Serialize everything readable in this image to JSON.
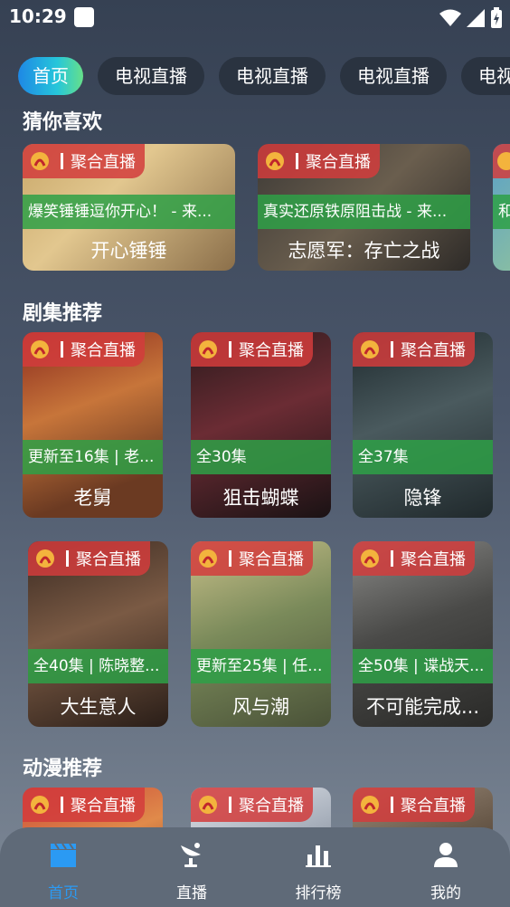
{
  "status": {
    "time": "10:29"
  },
  "tabs": [
    "首页",
    "电视直播",
    "电视直播",
    "电视直播",
    "电视"
  ],
  "sections": {
    "guess": "猜你喜欢",
    "series": "剧集推荐",
    "anime": "动漫推荐"
  },
  "tag_label": "聚合直播",
  "guess_cards": [
    {
      "info": "爆笑锤锤逗你开心！ - 来...",
      "title": "开心锤锤"
    },
    {
      "info": "真实还原铁原阻击战 - 来...",
      "title": "志愿军：存亡之战"
    },
    {
      "info": "和",
      "title": ""
    }
  ],
  "series_cards": [
    {
      "info": "更新至16集 | 老...",
      "title": "老舅"
    },
    {
      "info": "全30集",
      "title": "狙击蝴蝶"
    },
    {
      "info": "全37集",
      "title": "隐锋"
    },
    {
      "info": "全40集 | 陈晓整...",
      "title": "大生意人"
    },
    {
      "info": "更新至25集 | 任...",
      "title": "风与潮"
    },
    {
      "info": "全50集 | 谍战天...",
      "title": "不可能完成..."
    }
  ],
  "anime_cards": [
    {
      "title": ""
    },
    {
      "title": ""
    },
    {
      "title": ""
    }
  ],
  "nav": [
    "首页",
    "直播",
    "排行榜",
    "我的"
  ],
  "colors": {
    "accent": "#2b9af3",
    "tag": "#d23c3c",
    "info": "#2ea046"
  }
}
